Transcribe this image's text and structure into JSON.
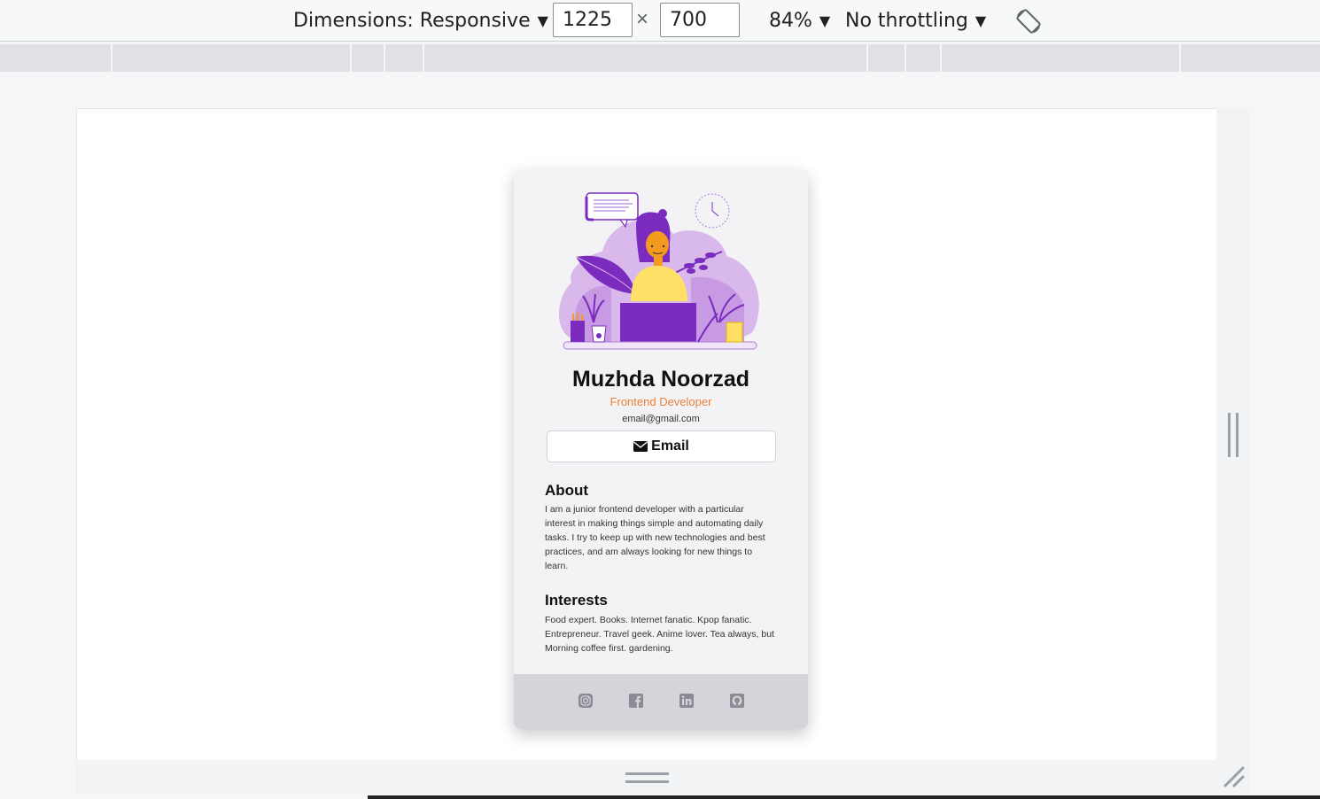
{
  "toolbar": {
    "dimensions_label": "Dimensions: Responsive",
    "width_value": "1225",
    "times": "×",
    "height_value": "700",
    "zoom_label": "84%",
    "throttling_label": "No throttling",
    "caret": "▼"
  },
  "card": {
    "name": "Muzhda Noorzad",
    "role": "Frontend Developer",
    "email": "email@gmail.com",
    "email_button": "Email",
    "about_title": "About",
    "about_text": "I am a junior frontend developer with a particular interest in making things simple and automating daily tasks. I try to keep up with new technologies and best practices, and am always looking for new things to learn.",
    "interests_title": "Interests",
    "interests_text": "Food expert. Books. Internet fanatic. Kpop fanatic. Entrepreneur. Travel geek. Anime lover. Tea always, but Morning coffee first. gardening.",
    "social_icons": [
      "instagram-icon",
      "facebook-icon",
      "linkedin-icon",
      "github-icon"
    ]
  },
  "colors": {
    "accent_orange": "#e9813a",
    "illustration_purple": "#7b2cbf",
    "illustration_light_purple": "#d9b8ec",
    "footer_bg": "#d4d4da",
    "card_bg": "#f3f3f5"
  }
}
